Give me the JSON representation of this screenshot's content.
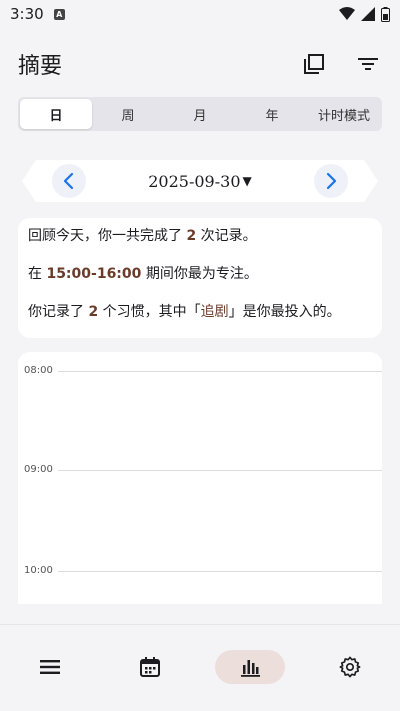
{
  "status_bar": {
    "time": "3:30",
    "notification_glyph": "A"
  },
  "header": {
    "title": "摘要"
  },
  "period_tabs": [
    {
      "label": "日",
      "active": true
    },
    {
      "label": "周",
      "active": false
    },
    {
      "label": "月",
      "active": false
    },
    {
      "label": "年",
      "active": false
    },
    {
      "label": "计时模式",
      "active": false
    }
  ],
  "date_nav": {
    "date": "2025-09-30",
    "caret": "▼"
  },
  "summary": {
    "line1_prefix": "回顾今天，你一共完成了 ",
    "record_count": "2",
    "line1_suffix": " 次记录。",
    "line2_prefix": "在 ",
    "focus_range": "15:00-16:00",
    "line2_suffix": " 期间你最为专注。",
    "line3_prefix": "你记录了 ",
    "habit_count": "2",
    "line3_middle": " 个习惯，其中「",
    "top_habit": "追剧",
    "line3_suffix": "」是你最投入的。"
  },
  "timeline": {
    "hours": [
      "08:00",
      "09:00",
      "10:00"
    ]
  },
  "bottom_nav": [
    {
      "icon": "list-icon",
      "active": false
    },
    {
      "icon": "calendar-icon",
      "active": false
    },
    {
      "icon": "bar-chart-icon",
      "active": true
    },
    {
      "icon": "gear-icon",
      "active": false
    }
  ],
  "colors": {
    "accent_blue": "#1a73e8",
    "highlight_brown": "#6b3b2a",
    "active_pill": "#ecdedb",
    "background": "#f4f4f7"
  }
}
